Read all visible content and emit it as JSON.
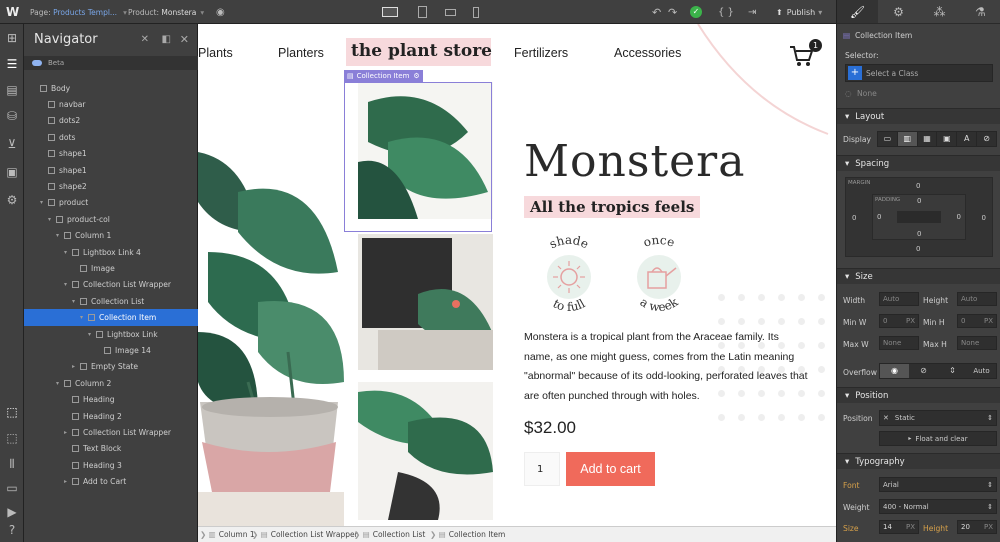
{
  "topbar": {
    "logo": "W",
    "page_label": "Page:",
    "page_value": "Products Templ...",
    "product_label": "Product:",
    "product_value": "Monstera",
    "publish": "Publish"
  },
  "navigator": {
    "title": "Navigator",
    "items": [
      {
        "label": "Body",
        "depth": 0,
        "arrow": "",
        "selected": false
      },
      {
        "label": "navbar",
        "depth": 1,
        "arrow": "",
        "selected": false
      },
      {
        "label": "dots2",
        "depth": 1,
        "arrow": "",
        "selected": false
      },
      {
        "label": "dots",
        "depth": 1,
        "arrow": "",
        "selected": false
      },
      {
        "label": "shape1",
        "depth": 1,
        "arrow": "",
        "selected": false
      },
      {
        "label": "shape1",
        "depth": 1,
        "arrow": "",
        "selected": false
      },
      {
        "label": "shape2",
        "depth": 1,
        "arrow": "",
        "selected": false
      },
      {
        "label": "product",
        "depth": 1,
        "arrow": "▾",
        "selected": false
      },
      {
        "label": "product-col",
        "depth": 2,
        "arrow": "▾",
        "selected": false
      },
      {
        "label": "Column 1",
        "depth": 3,
        "arrow": "▾",
        "selected": false
      },
      {
        "label": "Lightbox Link 4",
        "depth": 4,
        "arrow": "▾",
        "selected": false
      },
      {
        "label": "Image",
        "depth": 5,
        "arrow": "",
        "selected": false
      },
      {
        "label": "Collection List Wrapper",
        "depth": 4,
        "arrow": "▾",
        "selected": false
      },
      {
        "label": "Collection List",
        "depth": 5,
        "arrow": "▾",
        "selected": false
      },
      {
        "label": "Collection Item",
        "depth": 6,
        "arrow": "▾",
        "selected": true
      },
      {
        "label": "Lightbox Link",
        "depth": 7,
        "arrow": "▾",
        "selected": false
      },
      {
        "label": "Image 14",
        "depth": 8,
        "arrow": "",
        "selected": false
      },
      {
        "label": "Empty State",
        "depth": 5,
        "arrow": "▸",
        "selected": false
      },
      {
        "label": "Column 2",
        "depth": 3,
        "arrow": "▾",
        "selected": false
      },
      {
        "label": "Heading",
        "depth": 4,
        "arrow": "",
        "selected": false
      },
      {
        "label": "Heading 2",
        "depth": 4,
        "arrow": "",
        "selected": false
      },
      {
        "label": "Collection List Wrapper",
        "depth": 4,
        "arrow": "▸",
        "selected": false
      },
      {
        "label": "Text Block",
        "depth": 4,
        "arrow": "",
        "selected": false
      },
      {
        "label": "Heading 3",
        "depth": 4,
        "arrow": "",
        "selected": false
      },
      {
        "label": "Add to Cart",
        "depth": 4,
        "arrow": "▸",
        "selected": false
      }
    ],
    "beta": "Beta"
  },
  "site": {
    "menu": [
      "Plants",
      "Planters",
      "Fertilizers",
      "Accessories"
    ],
    "logo": "the plant store",
    "cart_count": "1",
    "title": "Monstera",
    "subtitle": "All the tropics feels",
    "badge1_top": "shade",
    "badge1_bottom": "to full",
    "badge2_top": "once",
    "badge2_bottom": "a week",
    "description": "Monstera is a tropical plant from the Araceae family. Its name, as one might guess, comes from the Latin meaning \"abnormal\" because of its odd-looking, perforated leaves that are often punched through with holes.",
    "price": "$32.00",
    "quantity": "1",
    "add_to_cart": "Add to cart",
    "collection_item_tag": "Collection Item"
  },
  "breadcrumb": [
    "Column 1",
    "Collection List Wrapper",
    "Collection List",
    "Collection Item"
  ],
  "right": {
    "element": "Collection Item",
    "selector_label": "Selector:",
    "select_class": "Select a Class",
    "none": "None",
    "layout": "Layout",
    "display": "Display",
    "spacing": "Spacing",
    "margin": "MARGIN",
    "padding": "PADDING",
    "zero": "0",
    "size": "Size",
    "width": "Width",
    "height": "Height",
    "min_w": "Min W",
    "min_h": "Min H",
    "max_w": "Max W",
    "max_h": "Max H",
    "auto": "Auto",
    "px": "PX",
    "none_val": "None",
    "overflow": "Overflow",
    "position_sec": "Position",
    "position": "Position",
    "static": "Static",
    "float": "Float and clear",
    "typography": "Typography",
    "font": "Font",
    "font_val": "Arial",
    "weight": "Weight",
    "weight_val": "400 - Normal",
    "size_lbl": "Size",
    "size_val": "14",
    "height_lbl": "Height",
    "height_val": "20"
  },
  "colors": {
    "accent": "#2a6fd6",
    "pink": "#f7d9dc",
    "cta": "#f06a5b",
    "green": "#3a7a5c"
  }
}
